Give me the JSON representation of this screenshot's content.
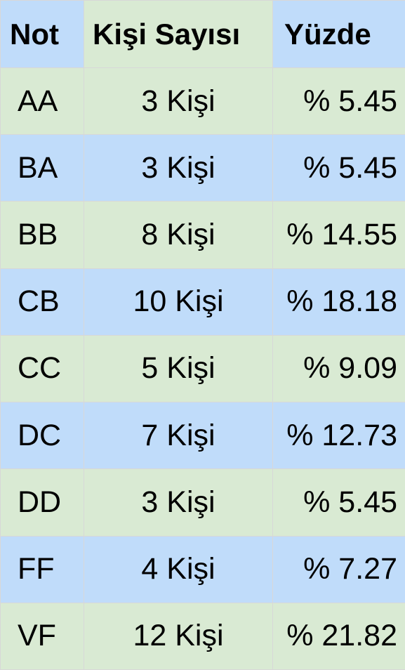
{
  "chart_data": {
    "type": "table",
    "columns": [
      "Not",
      "Kişi Sayısı",
      "Yüzde"
    ],
    "rows": [
      {
        "grade": "AA",
        "count": "3 Kişi",
        "percent": "% 5.45"
      },
      {
        "grade": "BA",
        "count": "3 Kişi",
        "percent": "% 5.45"
      },
      {
        "grade": "BB",
        "count": "8 Kişi",
        "percent": "% 14.55"
      },
      {
        "grade": "CB",
        "count": "10 Kişi",
        "percent": "% 18.18"
      },
      {
        "grade": "CC",
        "count": "5 Kişi",
        "percent": "% 9.09"
      },
      {
        "grade": "DC",
        "count": "7 Kişi",
        "percent": "% 12.73"
      },
      {
        "grade": "DD",
        "count": "3 Kişi",
        "percent": "% 5.45"
      },
      {
        "grade": "FF",
        "count": "4 Kişi",
        "percent": "% 7.27"
      },
      {
        "grade": "VF",
        "count": "12 Kişi",
        "percent": "% 21.82"
      }
    ],
    "row_colors": [
      "#d9ead3",
      "#c0dcfa"
    ],
    "header_colors": [
      "#c0dcfa",
      "#d9ead3",
      "#c0dcfa"
    ]
  }
}
